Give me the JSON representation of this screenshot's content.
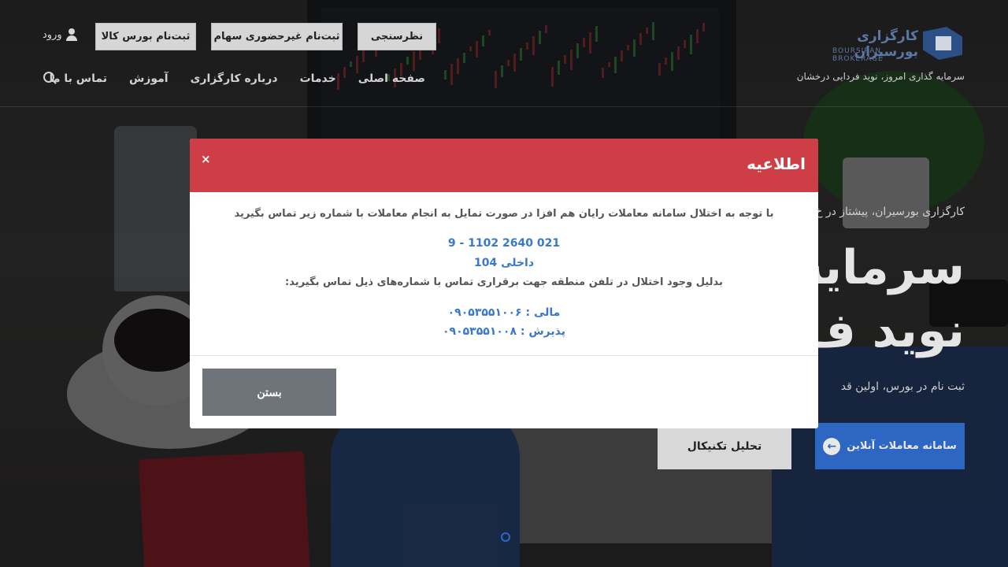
{
  "header": {
    "logo_text": "کارگزاری بورسیران",
    "logo_latin": "BOURSIRAN BROKERAGE",
    "tagline": "سرمایه گذاری امروز، نوید فردایی درخشان",
    "buttons": {
      "survey": "نظرسنجی",
      "stock_registration": "ثبت‌نام غیرحضوری سهام",
      "commodity_registration": "ثبت‌نام بورس کالا"
    },
    "login_label": "ورود",
    "nav": [
      "صفحه اصلی",
      "خدمات",
      "درباره کارگزاری",
      "آموزش",
      "تماس با ما"
    ]
  },
  "hero": {
    "subtitle": "کارگزاری بورسیران، پیشتاز در خ",
    "title_line1": "سرمایه",
    "title_line2": "نوید ف",
    "description": "ثبت نام در بورس، اولین قد",
    "btn_online": "سامانه معاملات آنلاین",
    "btn_technical": "تحلیل تکنیکال"
  },
  "modal": {
    "title": "اطلاعیه",
    "close_symbol": "×",
    "line1": "با توجه به اختلال سامانه معاملات رایان هم افزا در صورت تمایل به انجام معاملات با شماره زیر تماس بگیرید",
    "phone": "021 2640 1102 - 9",
    "extension": "داخلی 104",
    "line2": "بدلیل وجود اختلال در تلفن منطقه جهت برقراری تماس با شماره‌های ذیل تماس بگیرید:",
    "finance": "مالی : ۰۹۰۵۳۵۵۱۰۰۶",
    "reception": "پذیرش : ۰۹۰۵۳۵۵۱۰۰۸",
    "close_button": "بستن"
  },
  "colors": {
    "modal_header": "#cd3e47",
    "link_blue": "#3a78c9",
    "close_button": "#6f747b",
    "online_button": "#2e67c3"
  }
}
